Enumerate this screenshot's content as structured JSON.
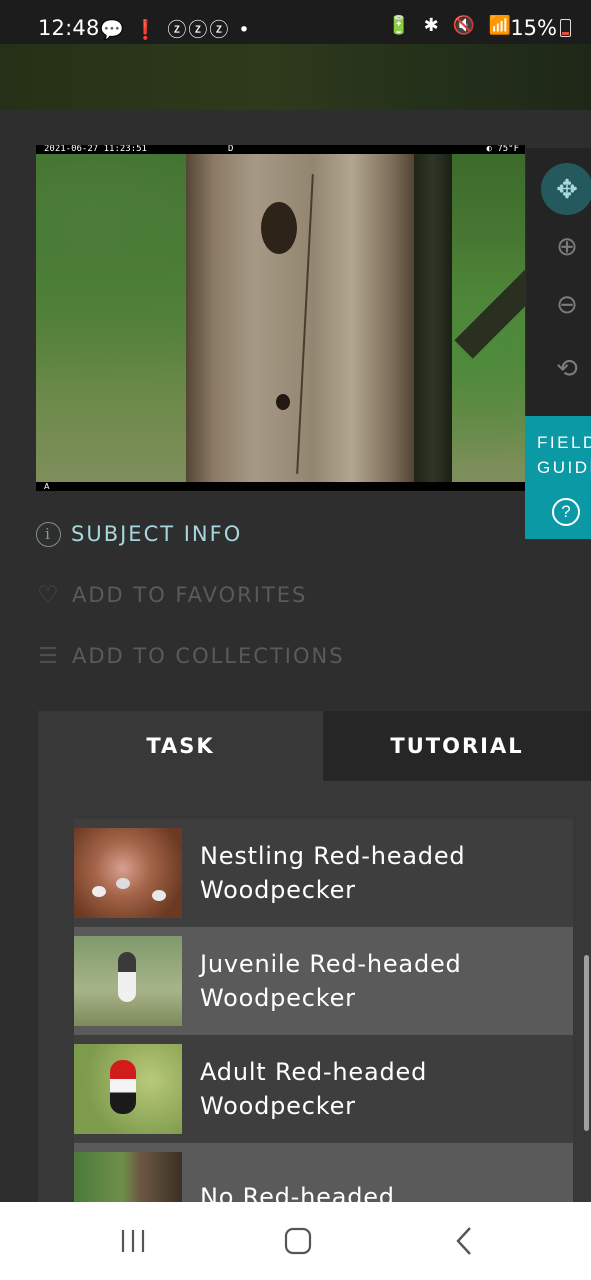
{
  "status_bar": {
    "time": "12:48",
    "left_icons": "💬 ❗ ⓩⓩⓩ •",
    "right_icons": "🔋 ✱ 🔇 📶",
    "battery_percent": "15%"
  },
  "subject_image": {
    "timestamp": "2021-06-27 11:23:51",
    "camera_code": "D",
    "temperature": "◐ 75°F",
    "footer_code": "A"
  },
  "image_tools": {
    "icons": [
      "move-icon",
      "zoom-in-icon",
      "zoom-out-icon",
      "rotate-icon"
    ],
    "move_glyph": "✥",
    "zoom_in_glyph": "⊕",
    "zoom_out_glyph": "⊖",
    "rotate_glyph": "⟲"
  },
  "field_guide": {
    "label": "FIELD\nGUIDE",
    "help_glyph": "?"
  },
  "meta_links": {
    "subject_info": "SUBJECT INFO",
    "subject_info_glyph": "i",
    "favorites": "ADD TO FAVORITES",
    "favorites_glyph": "♡",
    "collections": "ADD TO COLLECTIONS",
    "collections_glyph": "☰"
  },
  "task_panel": {
    "tabs": [
      {
        "label": "TASK",
        "active": true
      },
      {
        "label": "TUTORIAL",
        "active": false
      }
    ],
    "choices": [
      {
        "label": "Nestling Red-headed\nWoodpecker",
        "thumb": "nestling"
      },
      {
        "label": "Juvenile Red-headed\nWoodpecker",
        "thumb": "juvenile"
      },
      {
        "label": "Adult Red-headed\nWoodpecker",
        "thumb": "adult"
      },
      {
        "label": "No Red-headed",
        "thumb": "none"
      }
    ]
  },
  "colors": {
    "accent_teal": "#0a99a5",
    "subject_info_text": "#a6d7de",
    "background": "#2e2e2e"
  }
}
